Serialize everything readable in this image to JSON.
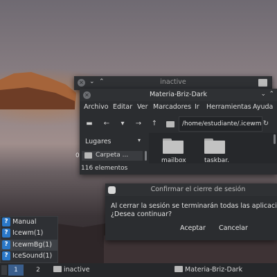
{
  "inactive_window": {
    "title": "inactive"
  },
  "file_window": {
    "title": "Materia-Briz-Dark",
    "menu": [
      "Archivo",
      "Editar",
      "Ver",
      "Marcadores",
      "Ir",
      "Herramientas",
      "Ayuda"
    ],
    "path": "/home/estudiante/.icewm",
    "sidebar_header": "Lugares",
    "sidebar_items": [
      "Carpeta ..."
    ],
    "files": [
      "mailbox",
      "taskbar."
    ],
    "status": "116 elementos",
    "left_edge_number": "0"
  },
  "dialog": {
    "title": "Confirmar el cierre de sesión",
    "message_line1": "Al cerrar la sesión se terminarán todas las aplicacio",
    "message_line2": "¿Desea continuar?",
    "accept": "Aceptar",
    "cancel": "Cancelar"
  },
  "start_menu": {
    "items": [
      "Manual",
      "Icewm(1)",
      "IcewmBg(1)",
      "IceSound(1)"
    ],
    "selected_index": 2
  },
  "taskbar": {
    "workspaces": [
      "1",
      "2"
    ],
    "tasks": [
      "inactive",
      "Materia-Briz-Dark"
    ]
  },
  "colors": {
    "accent": "#3a5e8c",
    "help_icon": "#2a78c8",
    "window_bg": "#2b2d30"
  }
}
